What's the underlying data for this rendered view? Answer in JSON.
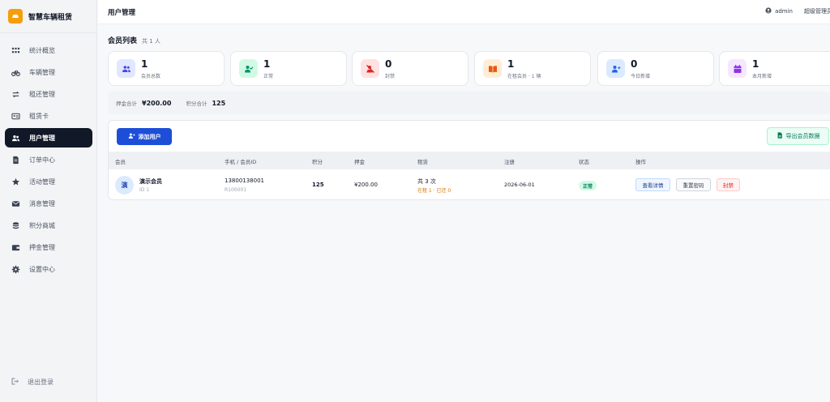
{
  "app": {
    "name": "智慧车辆租赁"
  },
  "sidebar": {
    "items": [
      {
        "label": "统计概览",
        "icon": "grid-icon"
      },
      {
        "label": "车辆管理",
        "icon": "bicycle-icon"
      },
      {
        "label": "租还管理",
        "icon": "swap-icon"
      },
      {
        "label": "租赁卡",
        "icon": "id-card-icon"
      },
      {
        "label": "用户管理",
        "icon": "users-icon",
        "active": true
      },
      {
        "label": "订单中心",
        "icon": "document-icon"
      },
      {
        "label": "活动管理",
        "icon": "star-icon"
      },
      {
        "label": "消息管理",
        "icon": "mail-icon"
      },
      {
        "label": "积分商城",
        "icon": "coins-icon"
      },
      {
        "label": "押金管理",
        "icon": "wallet-icon"
      },
      {
        "label": "设置中心",
        "icon": "gear-icon"
      }
    ],
    "logout": "退出登录"
  },
  "topbar": {
    "title": "用户管理",
    "user": "admin",
    "role": "超级管理员"
  },
  "list": {
    "title": "会员列表",
    "count": "共 1 人"
  },
  "stats": [
    {
      "value": "1",
      "label": "会员总数",
      "icon": "users-icon",
      "bg": "#e0e7ff",
      "fg": "#4f46e5"
    },
    {
      "value": "1",
      "label": "正常",
      "icon": "user-check-icon",
      "bg": "#d1fae5",
      "fg": "#059669"
    },
    {
      "value": "0",
      "label": "封禁",
      "icon": "user-slash-icon",
      "bg": "#fee2e2",
      "fg": "#dc2626"
    },
    {
      "value": "1",
      "label": "在租会员 · 1 辆",
      "icon": "book-open-icon",
      "bg": "#ffedd5",
      "fg": "#ea580c"
    },
    {
      "value": "0",
      "label": "今日新增",
      "icon": "user-plus-icon",
      "bg": "#dbeafe",
      "fg": "#2563eb"
    },
    {
      "value": "1",
      "label": "本月新增",
      "icon": "calendar-icon",
      "bg": "#f3e8ff",
      "fg": "#9333ea"
    }
  ],
  "summary": {
    "deposit_label": "押金合计",
    "deposit_value": "¥200.00",
    "points_label": "积分合计",
    "points_value": "125"
  },
  "toolbar": {
    "add_label": "添加用户",
    "export_label": "导出会员数据"
  },
  "table": {
    "headers": [
      "会员",
      "手机 / 会员ID",
      "积分",
      "押金",
      "租赁",
      "注册",
      "状态",
      "操作"
    ],
    "rows": [
      {
        "avatar": "演",
        "name": "演示会员",
        "id": "ID 1",
        "phone": "13800138001",
        "member_id": "R100001",
        "points": "125",
        "deposit": "¥200.00",
        "rent_total": "共 3 次",
        "rent_detail": "在租 1 · 已还 0",
        "registered": "2026-06-01",
        "status": "正常",
        "actions": {
          "view": "查看详情",
          "reset": "重置密码",
          "ban": "封禁"
        }
      }
    ]
  },
  "colors": {
    "accent": "#1d4ed8",
    "active_nav": "#111827",
    "brand": "#f59e0b"
  }
}
